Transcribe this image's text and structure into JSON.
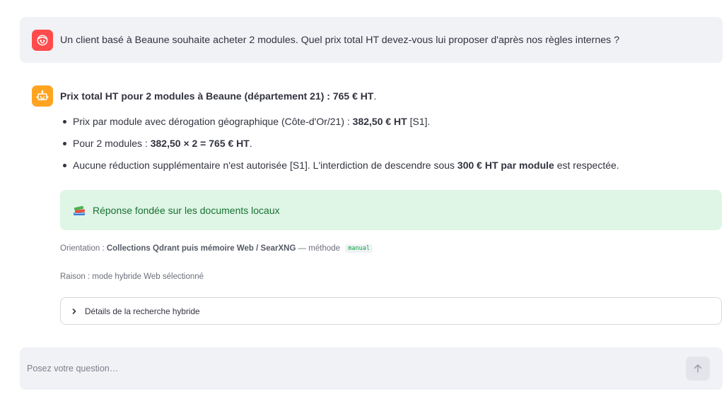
{
  "user_message": {
    "text": "Un client basé à Beaune souhaite acheter 2 modules. Quel prix total HT devez-vous lui proposer d'après nos règles internes ?",
    "avatar_icon": "user-face-icon",
    "avatar_color": "#ff4b4b"
  },
  "assistant": {
    "avatar_icon": "robot-icon",
    "avatar_color": "#ffa421",
    "title_bold": "Prix total HT pour 2 modules à Beaune (département 21) : 765 € HT",
    "title_end": ".",
    "bullets": [
      {
        "pre": "Prix par module avec dérogation géographique (Côte-d'Or/21) : ",
        "bold": "382,50 € HT",
        "post": " [S1]."
      },
      {
        "pre": "Pour 2 modules : ",
        "bold": "382,50 × 2 = 765 € HT",
        "post": "."
      },
      {
        "pre": "Aucune réduction supplémentaire n'est autorisée [S1]. L'interdiction de descendre sous ",
        "bold": "300 € HT par module",
        "post": " est respectée."
      }
    ],
    "success": {
      "icon": "books-icon",
      "text": "Réponse fondée sur les documents locaux",
      "color": "#177233"
    },
    "orientation": {
      "prefix": "Orientation : ",
      "bold": "Collections Qdrant puis mémoire Web / SearXNG",
      "middle": " — méthode ",
      "code": "manual"
    },
    "reason": "Raison : mode hybride Web sélectionné",
    "expander": {
      "icon": "chevron-right-icon",
      "label": "Détails de la recherche hybride"
    }
  },
  "chat_input": {
    "placeholder": "Posez votre question…",
    "send_icon": "arrow-up-icon"
  }
}
